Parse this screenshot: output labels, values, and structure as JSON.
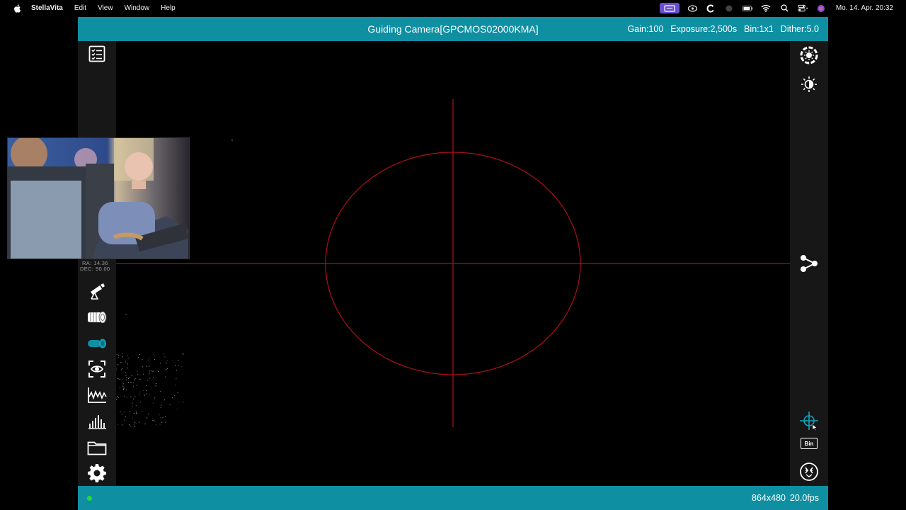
{
  "menubar": {
    "app_name": "StellaVita",
    "items": [
      "Edit",
      "View",
      "Window",
      "Help"
    ],
    "datetime": "Mo. 14. Apr.  20:32"
  },
  "window": {
    "title": "Guiding Camera[GPCMOS02000KMA]",
    "gain": "Gain:100",
    "exposure": "Exposure:2,500s",
    "bin": "Bin:1x1",
    "dither": "Dither:5.0"
  },
  "mount": {
    "ra_label": "RA:",
    "ra_value": "14.36",
    "dec_label": "DEC:",
    "dec_value": "90.00"
  },
  "status": {
    "resolution": "864x480",
    "fps": "20.0fps"
  },
  "right_tools": {
    "bin_label": "Bin"
  },
  "colors": {
    "accent": "#0f8fa2",
    "crosshair": "#b0101a",
    "connected": "#22dd33"
  }
}
